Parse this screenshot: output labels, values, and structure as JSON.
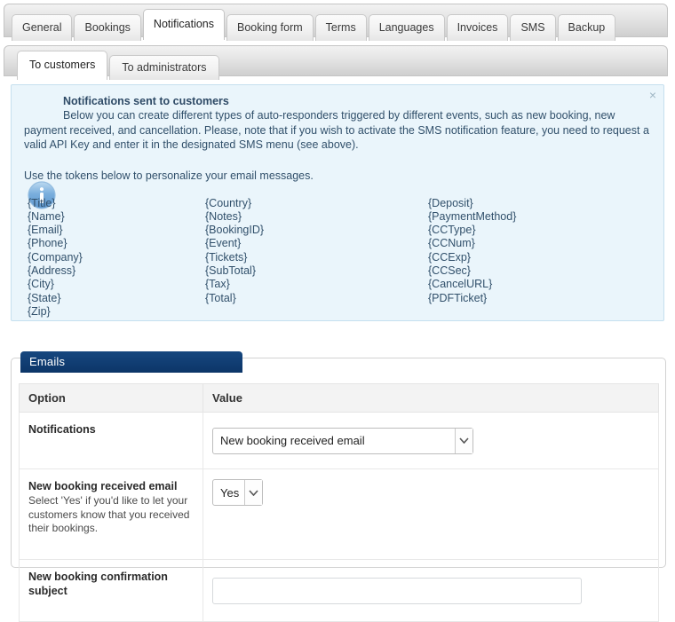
{
  "main_tabs": [
    {
      "label": "General",
      "active": false
    },
    {
      "label": "Bookings",
      "active": false
    },
    {
      "label": "Notifications",
      "active": true
    },
    {
      "label": "Booking form",
      "active": false
    },
    {
      "label": "Terms",
      "active": false
    },
    {
      "label": "Languages",
      "active": false
    },
    {
      "label": "Invoices",
      "active": false
    },
    {
      "label": "SMS",
      "active": false
    },
    {
      "label": "Backup",
      "active": false
    }
  ],
  "sub_tabs": [
    {
      "label": "To customers",
      "active": true
    },
    {
      "label": "To administrators",
      "active": false
    }
  ],
  "notice": {
    "title": "Notifications sent to customers",
    "body": "Below you can create different types of auto-responders triggered by different events, such as new booking, new payment received, and cancellation. Please, note that if you wish to activate the SMS notification feature, you need to request a valid API Key and enter it in the designated SMS menu (see above).",
    "tokens_intro": "Use the tokens below to personalize your email messages.",
    "close_label": "×",
    "icon": "info-icon",
    "accent_color": "#eaf5fb",
    "border_color": "#c5e0ef",
    "text_color": "#31506b"
  },
  "tokens": {
    "column_1": [
      "{Title}",
      "{Name}",
      "{Email}",
      "{Phone}",
      "{Company}",
      "{Address}",
      "{City}",
      "{State}",
      "{Zip}"
    ],
    "column_2": [
      "{Country}",
      "{Notes}",
      "{BookingID}",
      "{Event}",
      "{Tickets}",
      "{SubTotal}",
      "{Tax}",
      "{Total}"
    ],
    "column_3": [
      "{Deposit}",
      "{PaymentMethod}",
      "{CCType}",
      "{CCNum}",
      "{CCExp}",
      "{CCSec}",
      "{CancelURL}",
      "{PDFTicket}"
    ]
  },
  "emails_panel": {
    "legend": "Emails",
    "legend_color": "#0d3b70",
    "columns": [
      "Option",
      "Value"
    ],
    "rows": [
      {
        "option_title": "Notifications",
        "option_desc": "",
        "control": "select",
        "value": "New booking received email"
      },
      {
        "option_title": "New booking received email",
        "option_desc": "Select 'Yes' if you'd like to let your customers know that you received their bookings.",
        "control": "select",
        "value": "Yes"
      },
      {
        "option_title": "New booking confirmation subject",
        "option_desc": "",
        "control": "text",
        "value": "",
        "placeholder": ""
      }
    ]
  }
}
